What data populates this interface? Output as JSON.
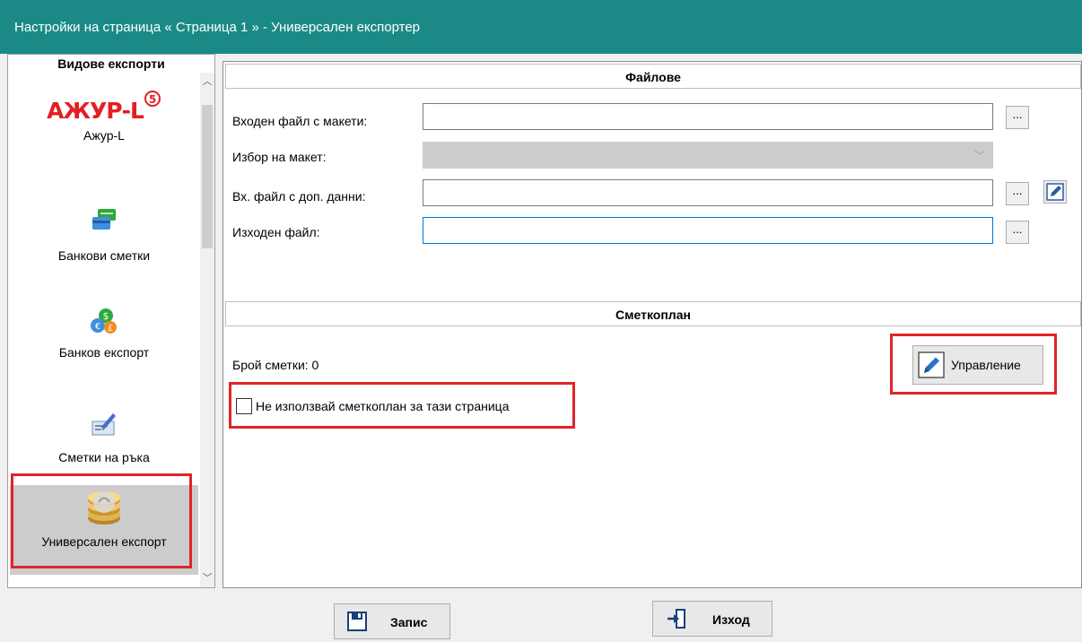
{
  "window": {
    "title": "Настройки на страница « Страница 1 » - Универсален експортер"
  },
  "sidebar": {
    "header": "Видове експорти",
    "items": [
      {
        "logo": "АЖУР-L",
        "logo_badge": "5",
        "label": "Ажур-L",
        "icon": "azhur-l-logo"
      },
      {
        "label": "Банкови сметки",
        "icon": "bank-accounts-icon"
      },
      {
        "label": "Банков експорт",
        "icon": "bank-export-icon"
      },
      {
        "label": "Сметки на ръка",
        "icon": "manual-accounts-icon"
      },
      {
        "label": "Универсален експорт",
        "icon": "universal-export-icon",
        "selected": true
      }
    ]
  },
  "files": {
    "header": "Файлове",
    "input_templates": {
      "label": "Входен файл с макети:",
      "value": ""
    },
    "template_choice": {
      "label": "Избор на макет:",
      "value": ""
    },
    "additional_data": {
      "label": "Вх. файл с доп. данни:",
      "value": ""
    },
    "output_file": {
      "label": "Изходен файл:",
      "value": ""
    },
    "browse_label": "..."
  },
  "chart_of_accounts": {
    "header": "Сметкоплан",
    "count_text": "Брой сметки: 0",
    "manage_label": "Управление",
    "checkbox_label": "Не използвай сметкоплан за тази страница",
    "checkbox_checked": false
  },
  "footer": {
    "save_label": "Запис",
    "exit_label": "Изход"
  },
  "colors": {
    "titlebar": "#1b8a86",
    "highlight": "#e0242a",
    "focus": "#0078d7"
  }
}
